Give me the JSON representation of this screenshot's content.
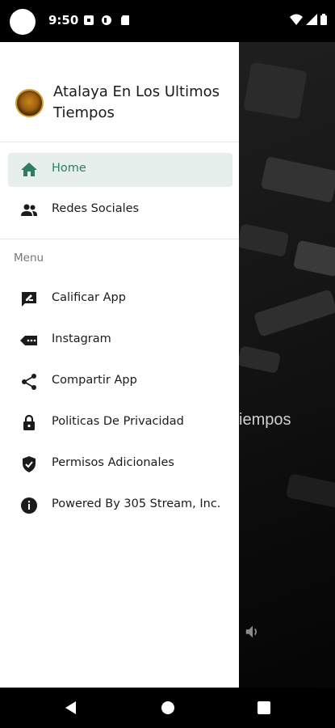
{
  "status_bar": {
    "time": "9:50"
  },
  "drawer": {
    "app_title": "Atalaya En Los Ultimos Tiempos",
    "primary_items": [
      {
        "label": "Home",
        "icon": "home-icon",
        "active": true
      },
      {
        "label": "Redes Sociales",
        "icon": "people-icon",
        "active": false
      }
    ],
    "section_label": "Menu",
    "menu_items": [
      {
        "label": "Calificar App",
        "icon": "rate-review-icon"
      },
      {
        "label": "Instagram",
        "icon": "label-icon"
      },
      {
        "label": "Compartir App",
        "icon": "share-icon"
      },
      {
        "label": "Politicas De Privacidad",
        "icon": "lock-icon"
      },
      {
        "label": "Permisos Adicionales",
        "icon": "verified-shield-icon"
      },
      {
        "label": "Powered By 305 Stream, Inc.",
        "icon": "info-icon"
      }
    ]
  },
  "background": {
    "title_fragment": "iempos"
  },
  "colors": {
    "accent": "#2e7d63",
    "active_bg": "#e6efeb",
    "drawer_bg": "#ffffff",
    "system_bar": "#000000"
  }
}
